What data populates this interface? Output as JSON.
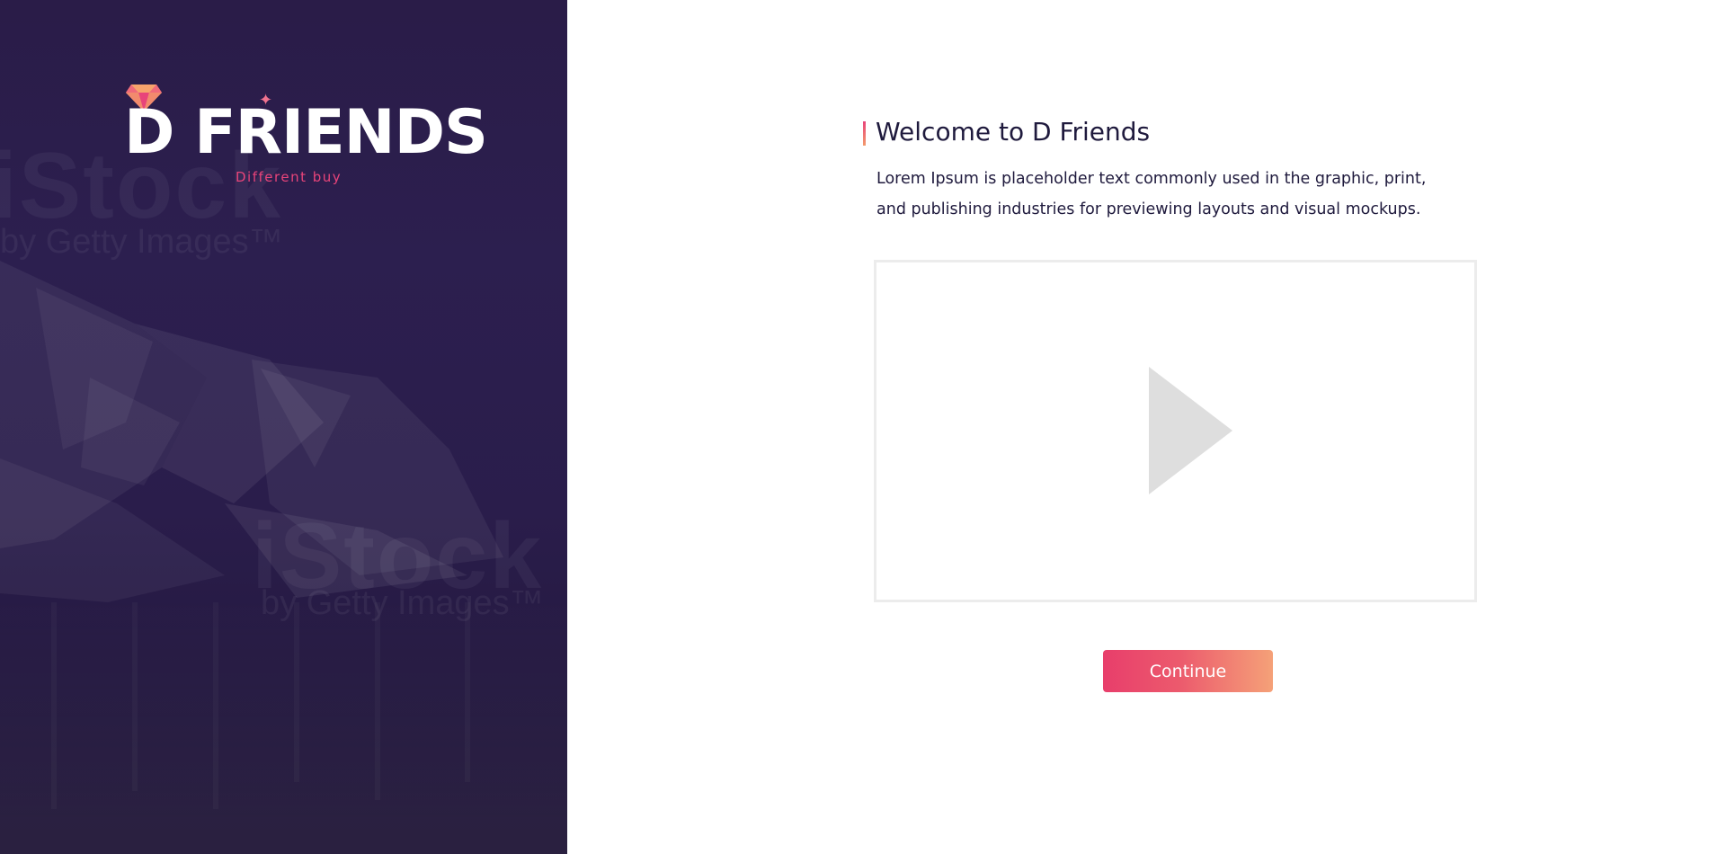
{
  "brand": {
    "name": "D FRIENDS",
    "tagline": "Different buy",
    "background_watermark": [
      "iStock",
      "by Getty Images™"
    ],
    "colors": {
      "panel": "#2a1c48",
      "accent": "#e8447a",
      "accent_end": "#f5a178"
    }
  },
  "welcome": {
    "title": "Welcome to D Friends",
    "description": "Lorem Ipsum is placeholder text commonly used in the graphic, print, and publishing industries for previewing layouts and visual mockups."
  },
  "video": {
    "icon": "play-icon"
  },
  "actions": {
    "continue_label": "Continue"
  }
}
